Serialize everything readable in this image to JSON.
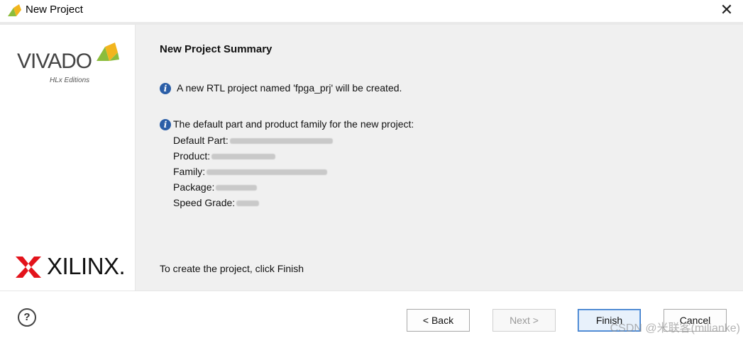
{
  "window": {
    "title": "New Project",
    "close_glyph": "✕"
  },
  "branding": {
    "vivado_word": "VIVADO",
    "vivado_sub": "HLx Editions",
    "xilinx_word": "XILINX."
  },
  "summary": {
    "title": "New Project Summary",
    "rtl_message": "A new RTL project named 'fpga_prj' will be created.",
    "part_intro": "The default part and product family for the new project:",
    "details": [
      {
        "label": "Default Part:",
        "value": ""
      },
      {
        "label": "Product:",
        "value": ""
      },
      {
        "label": "Family:",
        "value": ""
      },
      {
        "label": "Package:",
        "value": ""
      },
      {
        "label": "Speed Grade:",
        "value": ""
      }
    ],
    "footer": "To create the project, click Finish"
  },
  "buttons": {
    "help": "?",
    "back": "< Back",
    "next": "Next >",
    "finish": "Finish",
    "cancel": "Cancel"
  },
  "watermark": "CSDN @米联客(milianke)",
  "colors": {
    "info_icon": "#2b5ea7",
    "primary_border": "#3778c9",
    "vivado_leaf_green": "#8cbd3c",
    "vivado_leaf_yellow": "#f2b51e",
    "xilinx_red": "#e3131b"
  },
  "icons": {
    "title": "vivado-app-icon",
    "info": "info-icon",
    "help": "help-icon",
    "close": "close-icon"
  }
}
